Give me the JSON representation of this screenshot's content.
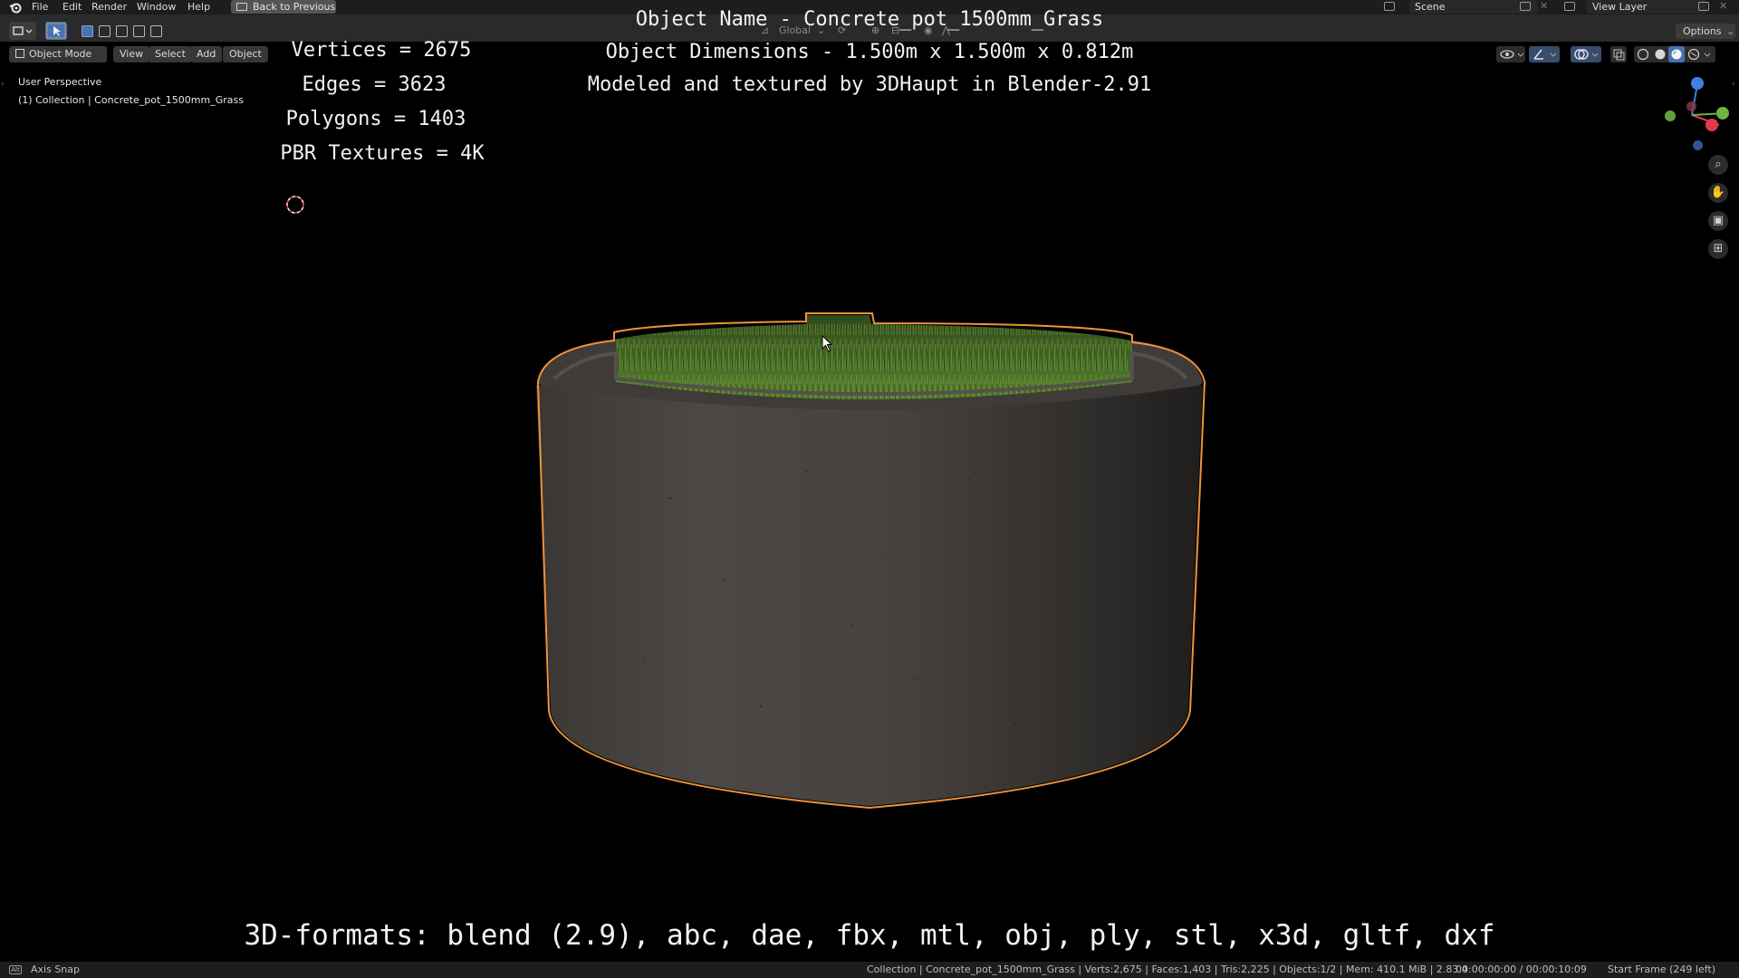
{
  "menu": {
    "items": [
      "File",
      "Edit",
      "Render",
      "Window",
      "Help"
    ],
    "back_button": "Back to Previous",
    "scene_label": "Scene",
    "view_layer_label": "View Layer"
  },
  "header": {
    "transform_orientation": "Global",
    "options_label": "Options"
  },
  "viewport_header": {
    "mode": "Object Mode",
    "menus": [
      "View",
      "Select",
      "Add",
      "Object"
    ]
  },
  "viewport": {
    "perspective_label": "User Perspective",
    "collection_label": "(1) Collection | Concrete_pot_1500mm_Grass"
  },
  "overlay": {
    "object_name": "Object Name - Concrete_pot_1500mm_Grass",
    "dimensions": "Object Dimensions -  1.500m x 1.500m x 0.812m",
    "credit": "Modeled and textured by 3DHaupt in Blender-2.91",
    "stats": [
      "Vertices = 2675",
      "Edges = 3623",
      "Polygons = 1403",
      "PBR Textures = 4K"
    ],
    "formats": "3D-formats: blend (2.9), abc, dae, fbx, mtl, obj, ply, stl, x3d, gltf, dxf"
  },
  "statusbar": {
    "left_hint": "Axis Snap",
    "stats": "Collection | Concrete_pot_1500mm_Grass | Verts:2,675 | Faces:1,403 | Tris:2,225 | Objects:1/2 | Mem: 410.1 MiB | 2.83.4",
    "timecode": "00:00:00:00 / 00:00:10:09",
    "frame": "Start Frame (249 left)"
  },
  "colors": {
    "selection_outline": "#f0933a",
    "accent_blue": "#4772b3",
    "axis_x": "#e23b4e",
    "axis_y": "#6db33f",
    "axis_z": "#3b82e2"
  },
  "icons": [
    "blender-logo-icon",
    "editor-type-icon",
    "select-cursor-icon",
    "zoom-icon",
    "hand-pan-icon",
    "camera-icon",
    "grid-view-icon",
    "3d-cursor-icon",
    "mouse-cursor-icon"
  ]
}
